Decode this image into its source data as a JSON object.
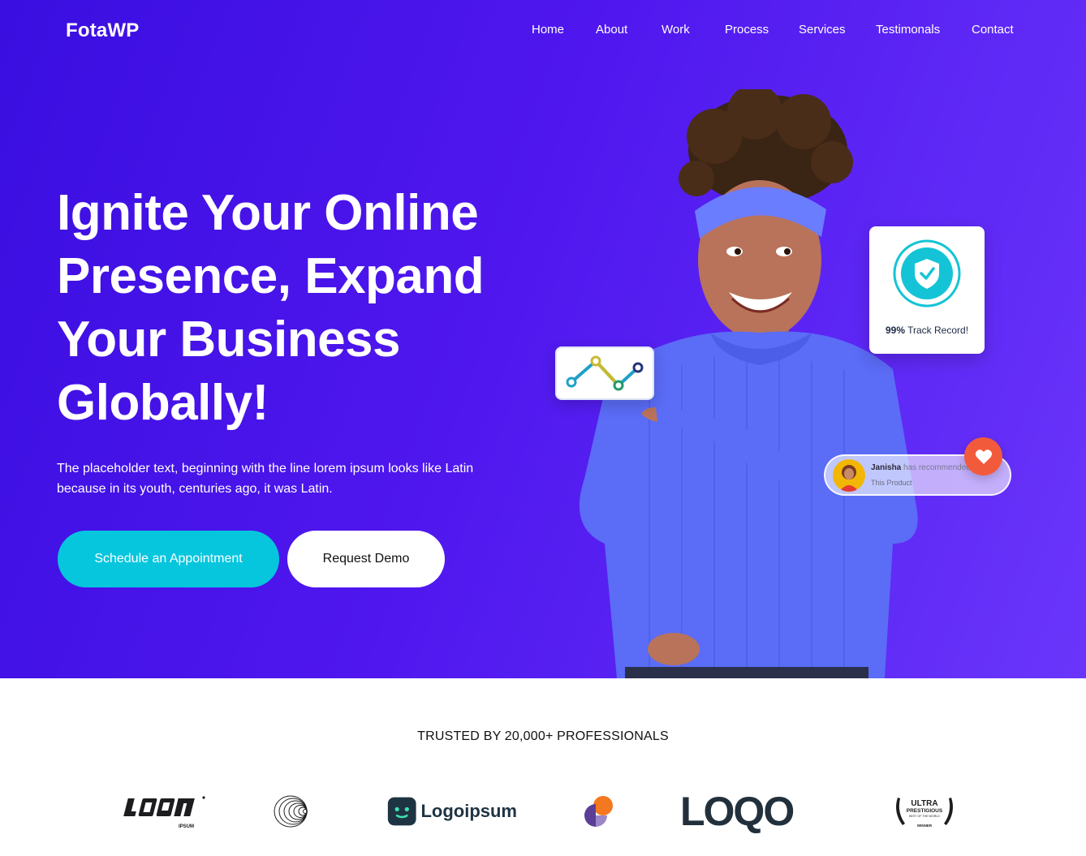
{
  "brand": {
    "name": "FotaWP"
  },
  "nav": {
    "items": [
      {
        "label": "Home"
      },
      {
        "label": "About"
      },
      {
        "label": "Work"
      },
      {
        "label": "Process"
      },
      {
        "label": "Services"
      },
      {
        "label": "Testimonals"
      },
      {
        "label": "Contact"
      }
    ]
  },
  "hero": {
    "headline_lines": [
      "Ignite Your Online",
      "Presence, Expand",
      "Your Business",
      "Globally!"
    ],
    "subtext_lines": [
      "The placeholder text, beginning with the line lorem ipsum looks like Latin",
      "because in its youth, centuries ago, it was Latin."
    ],
    "primary_button": "Schedule an Appointment",
    "secondary_button": "Request Demo"
  },
  "cards": {
    "track_record": {
      "value": "99%",
      "label": "Track Record!"
    },
    "recommendation": {
      "name": "Janisha",
      "action": "has recommended",
      "product": "This Product"
    }
  },
  "trusted": {
    "label": "TRUSTED BY 20,000+ PROFESSIONALS"
  },
  "partner_logos": {
    "logoipsum_word": "Logoipsum",
    "loqo_word": "LOQO",
    "ultra": {
      "line1": "ULTRA",
      "line2": "PRESTIGIOUS",
      "line3": "BEST OF THE WORLD",
      "line4": "WINNER"
    },
    "ipsum_tag": "IPSUM"
  },
  "colors": {
    "hero_gradient_start": "#3a0ee0",
    "hero_gradient_end": "#6a35fb",
    "primary_button": "#06c6de",
    "heart_badge": "#f25a3c",
    "sweater": "#5b6cf6"
  },
  "icons": {
    "shield": "shield-check-icon",
    "heart": "heart-icon",
    "chart": "line-chart-icon"
  }
}
